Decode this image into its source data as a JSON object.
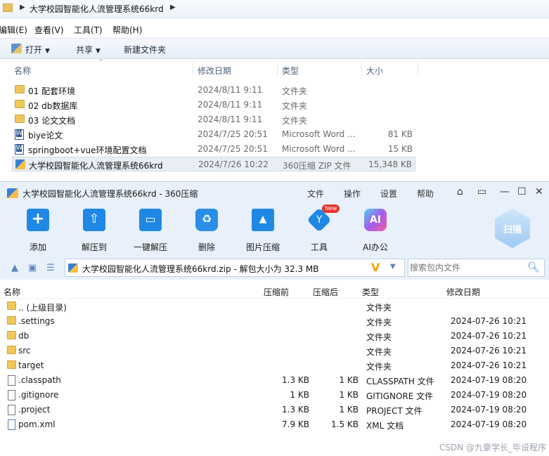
{
  "explorer": {
    "address": "大学校园智能化人流管理系统66krd",
    "menu": [
      "编辑(E)",
      "查看(V)",
      "工具(T)",
      "帮助(H)"
    ],
    "toolbar": {
      "open": "打开",
      "share": "共享",
      "new_folder": "新建文件夹"
    },
    "columns": {
      "name": "名称",
      "date": "修改日期",
      "type": "类型",
      "size": "大小"
    },
    "rows": [
      {
        "name": "01 配套环境",
        "date": "2024/8/11 9:11",
        "type": "文件夹",
        "size": "",
        "icon": "folder-icon"
      },
      {
        "name": "02 db数据库",
        "date": "2024/8/11 9:11",
        "type": "文件夹",
        "size": "",
        "icon": "folder-icon"
      },
      {
        "name": "03 论文文档",
        "date": "2024/8/11 9:11",
        "type": "文件夹",
        "size": "",
        "icon": "folder-icon"
      },
      {
        "name": "biye论文",
        "date": "2024/7/25 20:51",
        "type": "Microsoft Word ...",
        "size": "81 KB",
        "icon": "word-icon"
      },
      {
        "name": "springboot+vue环境配置文档",
        "date": "2024/7/25 20:51",
        "type": "Microsoft Word ...",
        "size": "15 KB",
        "icon": "word-icon"
      },
      {
        "name": "大学校园智能化人流管理系统66krd",
        "date": "2024/7/26 10:22",
        "type": "360压缩 ZIP 文件",
        "size": "15,348 KB",
        "icon": "zip-icon"
      }
    ]
  },
  "zip": {
    "title": "大学校园智能化人流管理系统66krd - 360压缩",
    "menu": [
      "文件",
      "操作",
      "设置",
      "帮助"
    ],
    "tools": [
      {
        "label": "添加",
        "icon": "add-icon"
      },
      {
        "label": "解压到",
        "icon": "extract-icon"
      },
      {
        "label": "一键解压",
        "icon": "one-click-extract-icon"
      },
      {
        "label": "删除",
        "icon": "delete-icon"
      },
      {
        "label": "图片压缩",
        "icon": "image-compress-icon"
      },
      {
        "label": "工具",
        "icon": "tools-icon"
      },
      {
        "label": "AI办公",
        "icon": "ai-icon"
      }
    ],
    "new_badge": "New",
    "scan": "扫描",
    "path": "大学校园智能化人流管理系统66krd.zip - 解包大小为 32.3 MB",
    "search_placeholder": "搜索包内文件",
    "columns": {
      "name": "名称",
      "compressed": "压缩前",
      "after": "压缩后",
      "type": "类型",
      "date": "修改日期"
    },
    "rows": [
      {
        "name": ".. (上级目录)",
        "before": "",
        "after": "",
        "type": "文件夹",
        "date": "",
        "icon": "folder-icon"
      },
      {
        "name": ".settings",
        "before": "",
        "after": "",
        "type": "文件夹",
        "date": "2024-07-26 10:21",
        "icon": "folder-icon"
      },
      {
        "name": "db",
        "before": "",
        "after": "",
        "type": "文件夹",
        "date": "2024-07-26 10:21",
        "icon": "folder-icon"
      },
      {
        "name": "src",
        "before": "",
        "after": "",
        "type": "文件夹",
        "date": "2024-07-26 10:21",
        "icon": "folder-icon"
      },
      {
        "name": "target",
        "before": "",
        "after": "",
        "type": "文件夹",
        "date": "2024-07-26 10:21",
        "icon": "folder-icon"
      },
      {
        "name": ".classpath",
        "before": "1.3 KB",
        "after": "1 KB",
        "type": "CLASSPATH 文件",
        "date": "2024-07-19 08:20",
        "icon": "file-icon"
      },
      {
        "name": ".gitignore",
        "before": "1 KB",
        "after": "1 KB",
        "type": "GITIGNORE 文件",
        "date": "2024-07-19 08:20",
        "icon": "file-icon"
      },
      {
        "name": ".project",
        "before": "1.3 KB",
        "after": "1 KB",
        "type": "PROJECT 文件",
        "date": "2024-07-19 08:20",
        "icon": "file-icon"
      },
      {
        "name": "pom.xml",
        "before": "7.9 KB",
        "after": "1.5 KB",
        "type": "XML 文档",
        "date": "2024-07-19 08:20",
        "icon": "xml-file-icon"
      }
    ]
  },
  "watermark": "CSDN @九豪学长_毕设程序"
}
